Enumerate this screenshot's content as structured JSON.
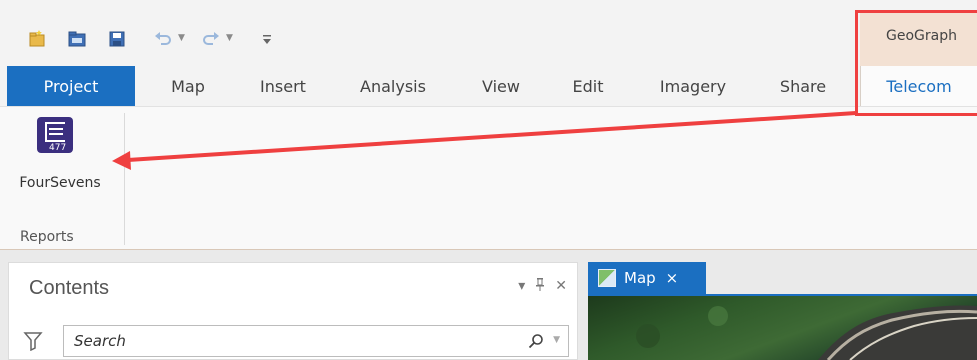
{
  "ribbon": {
    "contextual_group": "GeoGraph",
    "tabs": [
      {
        "label": "Project"
      },
      {
        "label": "Map"
      },
      {
        "label": "Insert"
      },
      {
        "label": "Analysis"
      },
      {
        "label": "View"
      },
      {
        "label": "Edit"
      },
      {
        "label": "Imagery"
      },
      {
        "label": "Share"
      },
      {
        "label": "Telecom"
      }
    ],
    "tool": {
      "label": "FourSevens",
      "icon_text": "477"
    },
    "group_label": "Reports"
  },
  "contents": {
    "title": "Contents",
    "search_placeholder": "Search"
  },
  "map_tab": {
    "label": "Map",
    "close": "×"
  },
  "colors": {
    "accent": "#1b6fc1",
    "annotation": "#ef4040",
    "contextual": "#f3e1d3"
  },
  "icons": [
    "new-project-icon",
    "open-project-icon",
    "save-project-icon",
    "undo-icon",
    "redo-icon",
    "customize-qat-icon",
    "filter-icon",
    "search-icon",
    "pin-icon",
    "close-icon"
  ]
}
